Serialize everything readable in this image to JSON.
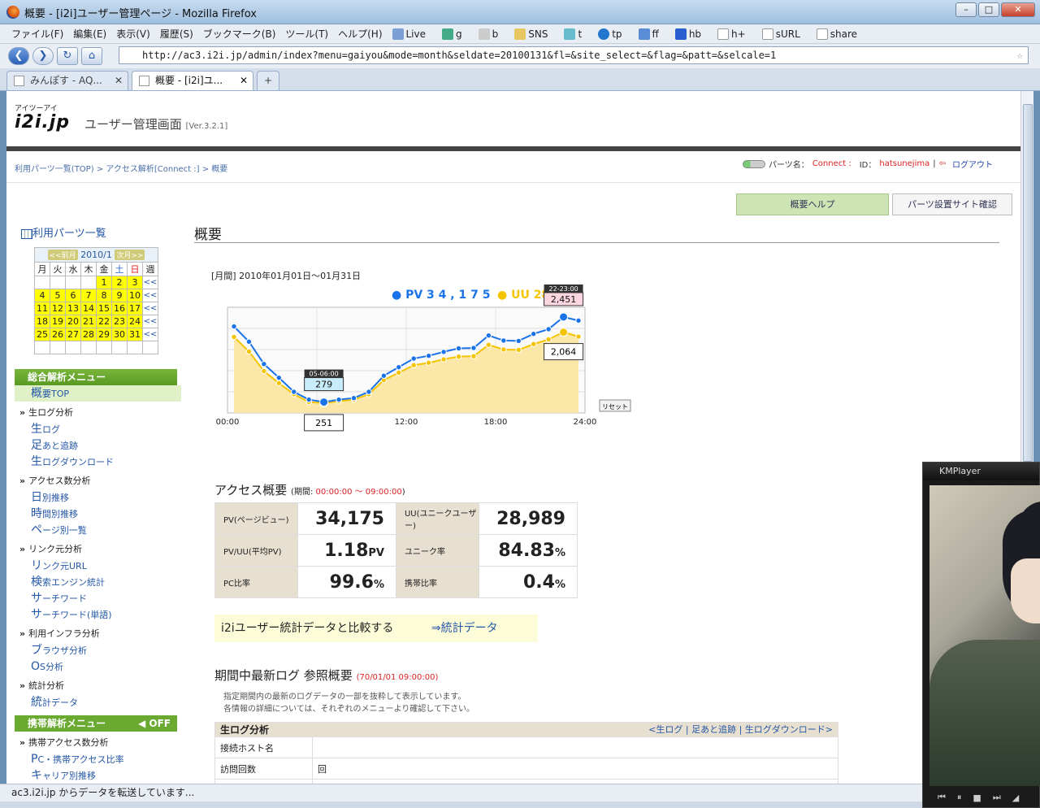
{
  "window": {
    "title": "概要 - [i2i]ユーザー管理ページ - Mozilla Firefox"
  },
  "menu": [
    "ファイル(F)",
    "編集(E)",
    "表示(V)",
    "履歴(S)",
    "ブックマーク(B)",
    "ツール(T)",
    "ヘルプ(H)"
  ],
  "bookmarks": [
    "Live",
    "g",
    "b",
    "SNS",
    "t",
    "tp",
    "ff",
    "hb",
    "h+",
    "sURL",
    "share"
  ],
  "url": "http://ac3.i2i.jp/admin/index?menu=gaiyou&mode=month&seldate=20100131&fl=&site_select=&flag=&patt=&selcale=1",
  "tabs": [
    {
      "label": "みんぽす - AQ..."
    },
    {
      "label": "概要 - [i2i]ユ..."
    },
    {
      "label": "+"
    }
  ],
  "status": "ac3.i2i.jp からデータを転送しています...",
  "header": {
    "logo_small": "アイツーアイ",
    "logo": "i2i.jp",
    "subtitle": "ユーザー管理画面",
    "version": "[Ver.3.2.1]",
    "breadcrumb": "利用パーツ一覧(TOP) > アクセス解析[Connect :] > 概要",
    "parts_label": "パーツ名：",
    "parts_name": "Connect :",
    "id_label": "ID：",
    "id_value": "hatsunejima",
    "logout": "ログアウト",
    "help_btn": "概要ヘルプ",
    "site_btn": "パーツ設置サイト確認"
  },
  "sidebar": {
    "parts_list": "利用パーツ一覧",
    "calendar": {
      "prev": "<<前月",
      "month": "2010/1",
      "next": "次月>>",
      "weekdays": [
        "月",
        "火",
        "水",
        "木",
        "金",
        "土",
        "日",
        "週"
      ],
      "rows": [
        [
          "",
          "",
          "",
          "",
          "1",
          "2",
          "3"
        ],
        [
          "4",
          "5",
          "6",
          "7",
          "8",
          "9",
          "10"
        ],
        [
          "11",
          "12",
          "13",
          "14",
          "15",
          "16",
          "17"
        ],
        [
          "18",
          "19",
          "20",
          "21",
          "22",
          "23",
          "24"
        ],
        [
          "25",
          "26",
          "27",
          "28",
          "29",
          "30",
          "31"
        ],
        [
          "",
          "",
          "",
          "",
          "",
          "",
          ""
        ]
      ],
      "week_marker": "<<"
    },
    "general_menu": "総合解析メニュー",
    "menu_sections": [
      {
        "items": [
          {
            "first": "概",
            "rest": "要TOP"
          }
        ]
      },
      {
        "group": "生ログ分析",
        "items": [
          {
            "first": "生",
            "rest": "ログ"
          },
          {
            "first": "足",
            "rest": "あと追跡"
          },
          {
            "first": "生",
            "rest": "ログダウンロード"
          }
        ]
      },
      {
        "group": "アクセス数分析",
        "items": [
          {
            "first": "日",
            "rest": "別推移"
          },
          {
            "first": "時",
            "rest": "間別推移"
          },
          {
            "first": "ペ",
            "rest": "ージ別一覧"
          }
        ]
      },
      {
        "group": "リンク元分析",
        "items": [
          {
            "first": "リ",
            "rest": "ンク元URL"
          },
          {
            "first": "検",
            "rest": "索エンジン統計"
          },
          {
            "first": "サ",
            "rest": "ーチワード"
          },
          {
            "first": "サ",
            "rest": "ーチワード(単語)"
          }
        ]
      },
      {
        "group": "利用インフラ分析",
        "items": [
          {
            "first": "ブ",
            "rest": "ラウザ分析"
          },
          {
            "first": "O",
            "rest": "S分析"
          }
        ]
      },
      {
        "group": "統計分析",
        "items": [
          {
            "first": "統",
            "rest": "計データ"
          }
        ]
      }
    ],
    "mobile_menu": "携帯解析メニュー",
    "mobile_off": "OFF",
    "mobile_group": "携帯アクセス数分析",
    "mobile_items": [
      {
        "first": "P",
        "rest": "C・携帯アクセス比率"
      },
      {
        "first": "キ",
        "rest": "ャリア別推移"
      }
    ]
  },
  "main": {
    "title": "概要",
    "period": "[月間] 2010年01月01日～01月31日",
    "access_title": "アクセス概要",
    "access_period_label": "(期間:",
    "access_period": "00:00:00 ～ 09:00:00",
    "access_period_end": ")",
    "stats": [
      {
        "label": "PV(ページビュー)",
        "value": "34,175",
        "unit": ""
      },
      {
        "label": "UU(ユニークユーザー)",
        "value": "28,989",
        "unit": ""
      },
      {
        "label": "PV/UU(平均PV)",
        "value": "1.18",
        "unit": "PV"
      },
      {
        "label": "ユニーク率",
        "value": "84.83",
        "unit": "%"
      },
      {
        "label": "PC比率",
        "value": "99.6",
        "unit": "%"
      },
      {
        "label": "携帯比率",
        "value": "0.4",
        "unit": "%"
      }
    ],
    "compare_text": "i2iユーザー統計データと比較する",
    "compare_link": "⇒統計データ",
    "recent_title": "期間中最新ログ 参照概要",
    "recent_date": "(70/01/01 09:00:00)",
    "recent_note1": "指定期間内の最新のログデータの一部を抜粋して表示しています。",
    "recent_note2": "各情報の詳細については、それぞれのメニューより確認して下さい。",
    "log_header": "生ログ分析",
    "log_links": "<生ログ | 足あと追跡 | 生ログダウンロード>",
    "log_rows": [
      {
        "label": "接続ホスト名",
        "value": ""
      },
      {
        "label": "訪問回数",
        "value": "回"
      }
    ]
  },
  "kmplayer": {
    "title": "KMPlayer"
  },
  "chart_data": {
    "type": "line",
    "x": [
      "00",
      "01",
      "02",
      "03",
      "04",
      "05",
      "06",
      "07",
      "08",
      "09",
      "10",
      "11",
      "12",
      "13",
      "14",
      "15",
      "16",
      "17",
      "18",
      "19",
      "20",
      "21",
      "22",
      "23"
    ],
    "series": [
      {
        "name": "PV",
        "total": "34,175",
        "color": "#1a73e8",
        "values": [
          2210,
          1820,
          1250,
          900,
          540,
          340,
          279,
          340,
          380,
          540,
          950,
          1170,
          1390,
          1460,
          1560,
          1650,
          1660,
          1980,
          1850,
          1840,
          2020,
          2140,
          2451,
          2360
        ]
      },
      {
        "name": "UU",
        "total": "28",
        "color": "#f5c400",
        "values": [
          1940,
          1570,
          1070,
          760,
          480,
          280,
          251,
          300,
          340,
          480,
          840,
          1030,
          1220,
          1280,
          1370,
          1440,
          1450,
          1740,
          1620,
          1610,
          1760,
          1880,
          2064,
          1950
        ]
      }
    ],
    "xticks": [
      "00:00",
      "06:00",
      "12:00",
      "18:00",
      "24:00"
    ],
    "ylim": [
      0,
      2700
    ],
    "grid": true,
    "annotations": [
      {
        "x": "05-06:00",
        "text": "279"
      },
      {
        "x": "",
        "text": "251"
      },
      {
        "x": "22-23:00",
        "text": "2,451"
      },
      {
        "x": "",
        "text": "2,064"
      }
    ],
    "reset": "リセット"
  }
}
